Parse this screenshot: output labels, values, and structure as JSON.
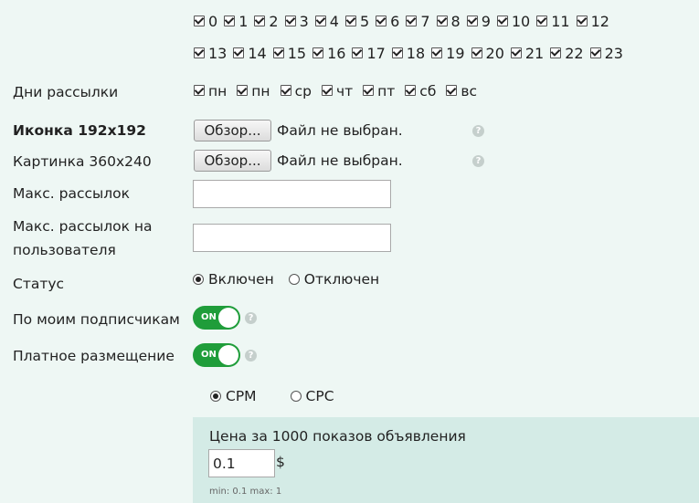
{
  "hours": {
    "row1": [
      "0",
      "1",
      "2",
      "3",
      "4",
      "5",
      "6",
      "7",
      "8",
      "9",
      "10",
      "11",
      "12"
    ],
    "row2": [
      "13",
      "14",
      "15",
      "16",
      "17",
      "18",
      "19",
      "20",
      "21",
      "22",
      "23"
    ]
  },
  "days": {
    "label": "Дни рассылки",
    "items": [
      "пн",
      "пн",
      "ср",
      "чт",
      "пт",
      "сб",
      "вс"
    ]
  },
  "icon_field": {
    "label": "Иконка 192x192",
    "button": "Обзор...",
    "status": "Файл не выбран."
  },
  "image_field": {
    "label": "Картинка 360x240",
    "button": "Обзор...",
    "status": "Файл не выбран."
  },
  "max_mailings": {
    "label": "Макс. рассылок",
    "value": ""
  },
  "max_per_user": {
    "label_line1": "Макс. рассылок на",
    "label_line2": "пользователя",
    "value": ""
  },
  "status": {
    "label": "Статус",
    "options": [
      "Включен",
      "Отключен"
    ],
    "selected": "Включен"
  },
  "my_subscribers": {
    "label": "По моим подписчикам",
    "toggle": "ON"
  },
  "paid_placement": {
    "label": "Платное размещение",
    "toggle": "ON"
  },
  "pricing_model": {
    "options": [
      "CPM",
      "CPC"
    ],
    "selected": "CPM"
  },
  "price": {
    "title": "Цена за 1000 показов объявления",
    "value": "0.1",
    "currency": "$",
    "hint": "min: 0.1 max: 1"
  },
  "help_glyph": "?",
  "colors": {
    "background": "#eef7f4",
    "toggle_on": "#1f9d3a",
    "price_panel": "#d4ebe6"
  }
}
